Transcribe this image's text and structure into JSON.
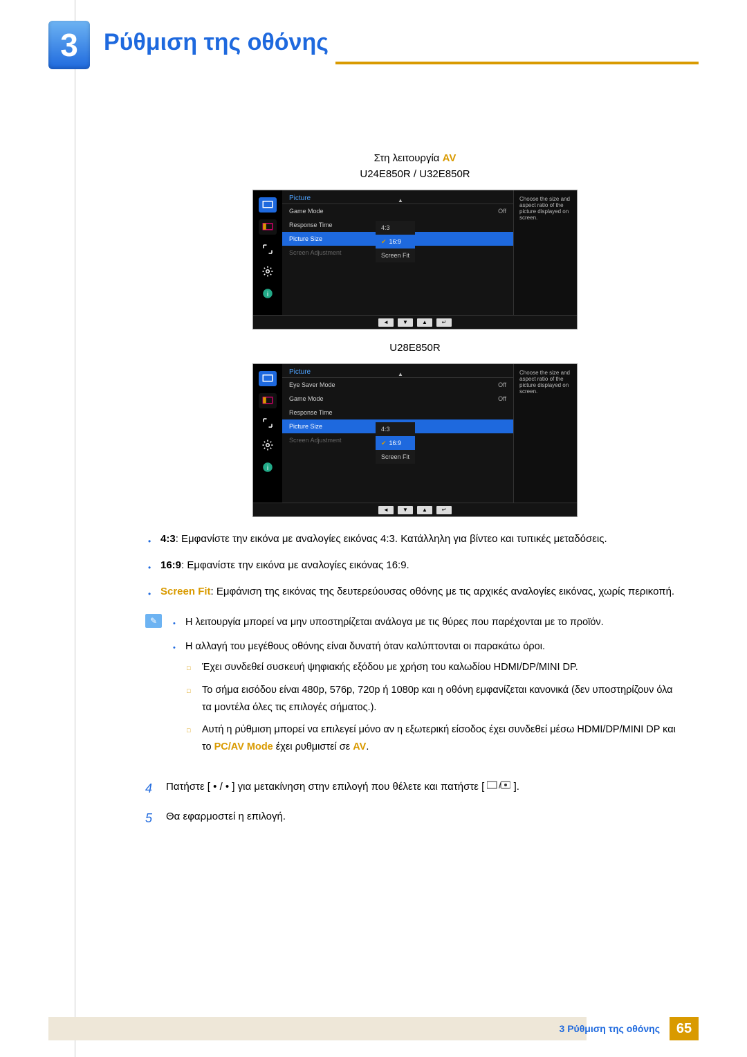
{
  "chapter": {
    "number": "3",
    "title": "Ρύθμιση της οθόνης"
  },
  "mode_intro": {
    "prefix": "Στη λειτουργία ",
    "mode": "AV"
  },
  "models_a": "U24E850R / U32E850R",
  "models_b": "U28E850R",
  "osd": {
    "section": "Picture",
    "desc": "Choose the size and aspect ratio of the picture displayed on screen.",
    "off": "Off",
    "rows_a": {
      "game_mode": "Game Mode",
      "response_time": "Response Time",
      "picture_size": "Picture Size",
      "screen_adjustment": "Screen Adjustment"
    },
    "rows_b": {
      "eye_saver": "Eye Saver Mode",
      "game_mode": "Game Mode",
      "response_time": "Response Time",
      "picture_size": "Picture Size",
      "screen_adjustment": "Screen Adjustment"
    },
    "options": {
      "r43": "4:3",
      "r169": "16:9",
      "fit": "Screen Fit"
    }
  },
  "bullets": {
    "b1": {
      "label": "4:3",
      "text": ": Εμφανίστε την εικόνα με αναλογίες εικόνας 4:3. Κατάλληλη για βίντεο και τυπικές μεταδόσεις."
    },
    "b2": {
      "label": "16:9",
      "text": ": Εμφανίστε την εικόνα με αναλογίες εικόνας 16:9."
    },
    "b3": {
      "label": "Screen Fit",
      "text": ": Εμφάνιση της εικόνας της δευτερεύουσας οθόνης με τις αρχικές αναλογίες εικόνας, χωρίς περικοπή."
    }
  },
  "note": {
    "n1": "Η λειτουργία μπορεί να μην υποστηρίζεται ανάλογα με τις θύρες που παρέχονται με το προϊόν.",
    "n2": "Η αλλαγή του μεγέθους οθόνης είναι δυνατή όταν καλύπτονται οι παρακάτω όροι.",
    "s1": "Έχει συνδεθεί συσκευή ψηφιακής εξόδου με χρήση του καλωδίου HDMI/DP/MINI DP.",
    "s2": "Το σήμα εισόδου είναι 480p, 576p, 720p ή 1080p και η οθόνη εμφανίζεται κανονικά (δεν υποστηρίζουν όλα τα μοντέλα όλες τις επιλογές σήματος.).",
    "s3_a": "Αυτή η ρύθμιση μπορεί να επιλεγεί μόνο αν η εξωτερική είσοδος έχει συνδεθεί μέσω HDMI/DP/MINI DP και το ",
    "s3_mode": "PC/AV Mode",
    "s3_b": " έχει ρυθμιστεί σε ",
    "s3_av": "AV",
    "s3_c": "."
  },
  "steps": {
    "s4": {
      "num": "4",
      "a": "Πατήστε [ • / • ] για μετακίνηση στην επιλογή που θέλετε και πατήστε [",
      "b": "]."
    },
    "s5": {
      "num": "5",
      "text": "Θα εφαρμοστεί η επιλογή."
    }
  },
  "footer": {
    "text": "3 Ρύθμιση της οθόνης",
    "page": "65"
  }
}
